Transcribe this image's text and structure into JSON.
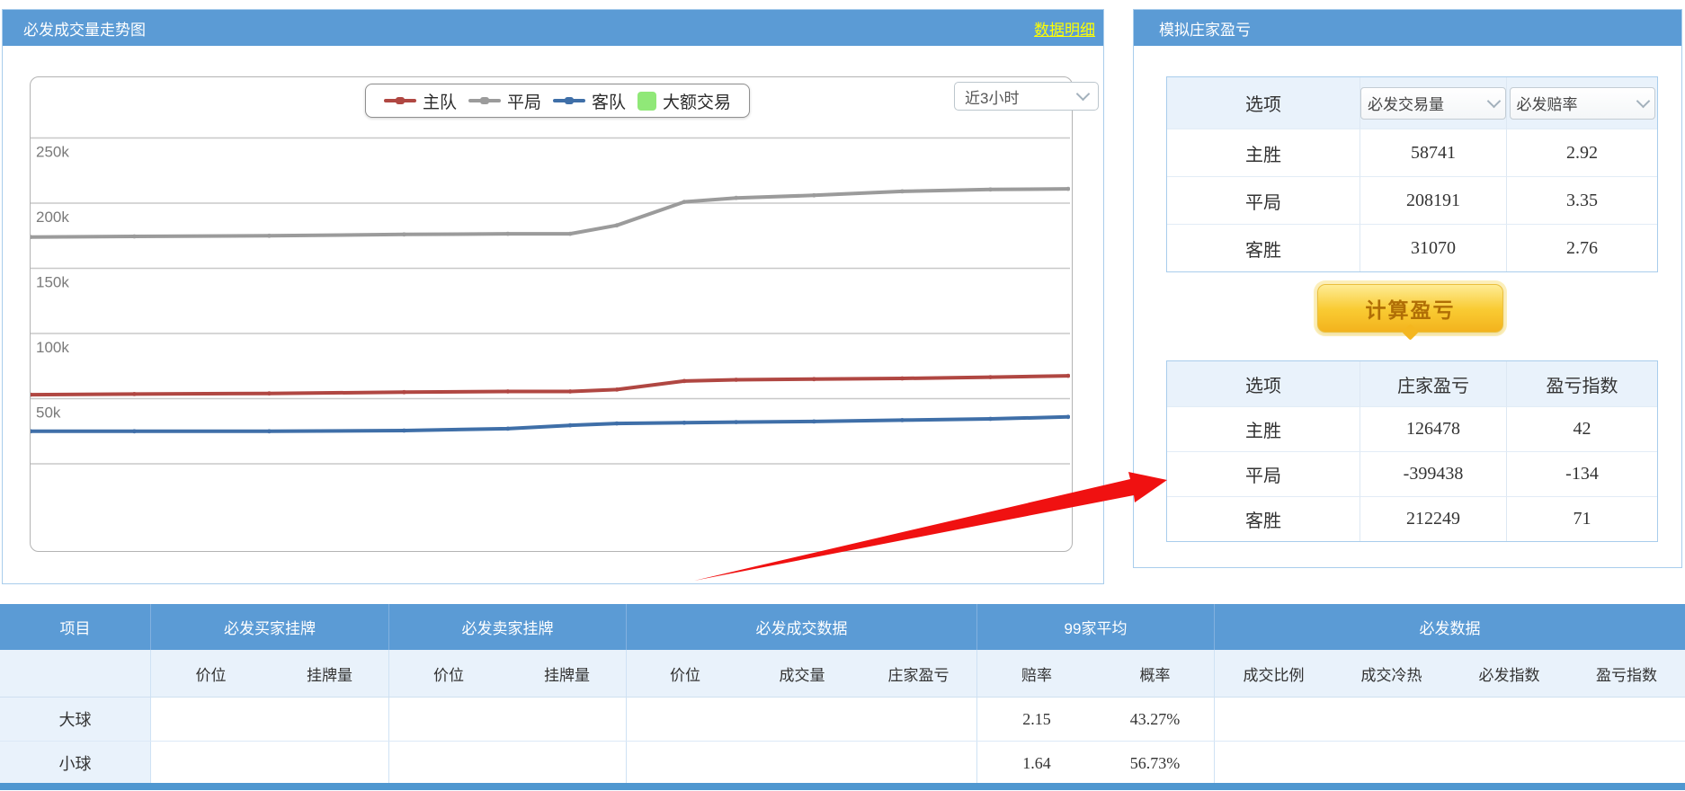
{
  "chart_data": {
    "type": "line",
    "title": "必发成交量走势图",
    "time_range": "近3小时",
    "unit": "k",
    "ylim": [
      0,
      300
    ],
    "y_ticks": [
      250,
      200,
      150,
      100,
      50
    ],
    "grid": "horizontal",
    "legend_position": "top-center",
    "x_fraction": [
      0,
      0.1,
      0.23,
      0.36,
      0.46,
      0.52,
      0.565,
      0.63,
      0.68,
      0.755,
      0.84,
      0.925,
      1.0
    ],
    "series": [
      {
        "name": "主队",
        "color": "#b04742",
        "values": [
          53,
          53.5,
          54,
          55,
          55.5,
          55.5,
          57,
          63.5,
          64.5,
          65,
          65.5,
          66.5,
          67.5
        ]
      },
      {
        "name": "平局",
        "color": "#9b9b9b",
        "values": [
          174,
          174.5,
          175,
          176,
          176.5,
          176.5,
          183,
          201,
          204,
          206,
          209,
          210.5,
          211
        ]
      },
      {
        "name": "客队",
        "color": "#3f6fa8",
        "values": [
          25,
          25,
          25,
          25.5,
          27,
          29.5,
          31,
          31.5,
          32,
          32.5,
          33.5,
          34.5,
          36
        ]
      }
    ],
    "legend_extra": {
      "name": "大额交易",
      "color": "#90e878"
    }
  },
  "left_panel": {
    "title": "必发成交量走势图",
    "detail_link": "数据明细"
  },
  "right_panel": {
    "title": "模拟庄家盈亏",
    "odds_table": {
      "col1_header": "选项",
      "dropdown1": "必发交易量",
      "dropdown2": "必发赔率",
      "rows": [
        [
          "主胜",
          "58741",
          "2.92"
        ],
        [
          "平局",
          "208191",
          "3.35"
        ],
        [
          "客胜",
          "31070",
          "2.76"
        ]
      ]
    },
    "calc_button": "计算盈亏",
    "pnl_table": {
      "headers": [
        "选项",
        "庄家盈亏",
        "盈亏指数"
      ],
      "rows": [
        [
          "主胜",
          "126478",
          "42"
        ],
        [
          "平局",
          "-399438",
          "-134"
        ],
        [
          "客胜",
          "212249",
          "71"
        ]
      ]
    }
  },
  "bottom_table": {
    "groups": [
      {
        "label": "项目"
      },
      {
        "label": "必发买家挂牌"
      },
      {
        "label": "必发卖家挂牌"
      },
      {
        "label": "必发成交数据"
      },
      {
        "label": "99家平均"
      },
      {
        "label": "必发数据"
      }
    ],
    "subheaders": [
      "",
      "价位",
      "挂牌量",
      "价位",
      "挂牌量",
      "价位",
      "成交量",
      "庄家盈亏",
      "赔率",
      "概率",
      "成交比例",
      "成交冷热",
      "必发指数",
      "盈亏指数"
    ],
    "rows": [
      {
        "label": "大球",
        "cells": [
          "",
          "",
          "",
          "",
          "",
          "",
          "",
          "2.15",
          "43.27%",
          "",
          "",
          "",
          ""
        ]
      },
      {
        "label": "小球",
        "cells": [
          "",
          "",
          "",
          "",
          "",
          "",
          "",
          "1.64",
          "56.73%",
          "",
          "",
          "",
          ""
        ]
      }
    ]
  },
  "colors": {
    "header_blue": "#5b9bd5",
    "panel_border": "#a9cdec",
    "link_yellow": "#ffff00",
    "button_gold": "#f7c52d",
    "arrow_red": "#f01111"
  }
}
